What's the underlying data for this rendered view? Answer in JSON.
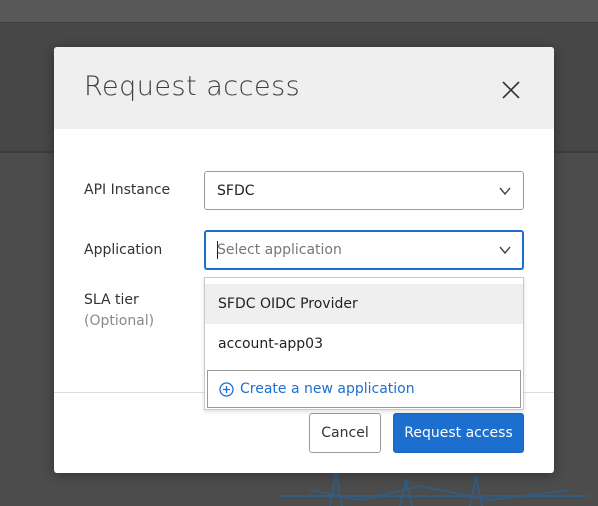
{
  "modal": {
    "title": "Request access",
    "api_instance_label": "API Instance",
    "api_instance_value": "SFDC",
    "application_label": "Application",
    "application_placeholder": "Select application",
    "sla_label": "SLA tier",
    "sla_optional": "(Optional)",
    "dropdown": {
      "items": [
        "SFDC OIDC Provider",
        "account-app03"
      ],
      "create_label": "Create a new application"
    },
    "cancel_label": "Cancel",
    "submit_label": "Request access"
  },
  "colors": {
    "primary": "#1d6fcf",
    "header_bg": "#efefef",
    "overlay": "#4a4a4a"
  },
  "icons": [
    "close-icon",
    "chevron-down-icon",
    "plus-circle-icon"
  ]
}
